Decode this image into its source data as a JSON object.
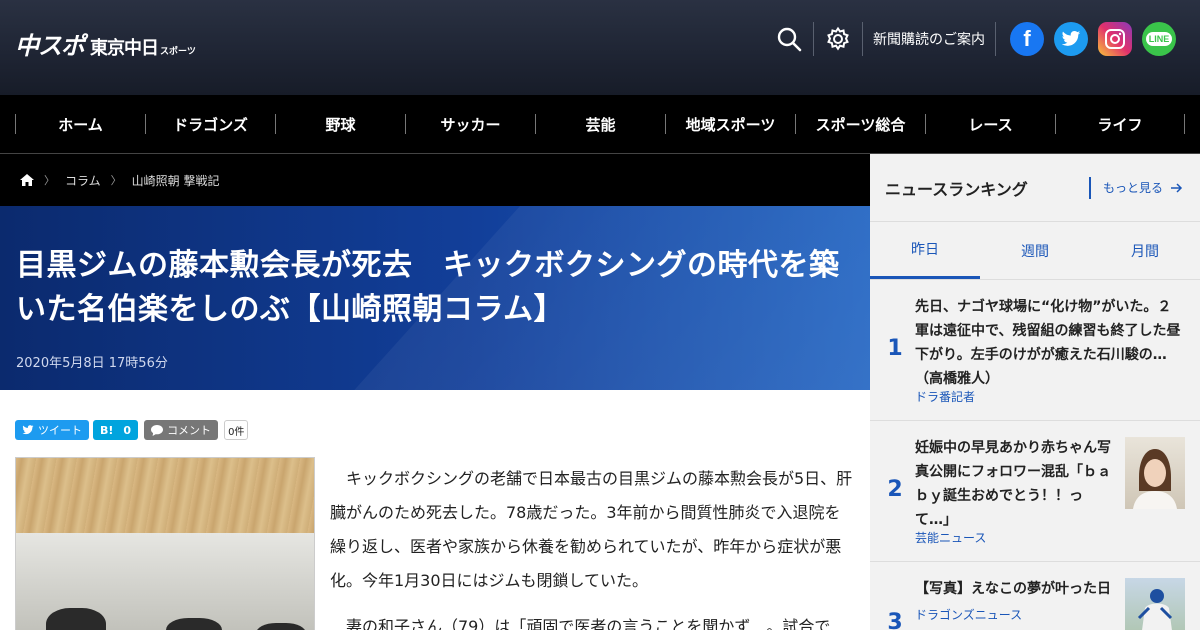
{
  "header": {
    "logo_main": "中スポ",
    "logo_sub": "東京中日",
    "logo_small": "スポーツ",
    "subscribe_label": "新聞購読のご案内",
    "social": [
      {
        "name": "facebook",
        "icon": "facebook-icon",
        "color": "#1877f2"
      },
      {
        "name": "twitter",
        "icon": "twitter-icon",
        "color": "#1d9bf0"
      },
      {
        "name": "instagram",
        "icon": "instagram-icon",
        "color": "#e1306c"
      },
      {
        "name": "line",
        "icon": "line-icon",
        "color": "#3ac44a",
        "label": "LINE"
      }
    ]
  },
  "nav": {
    "items": [
      "ホーム",
      "ドラゴンズ",
      "野球",
      "サッカー",
      "芸能",
      "地域スポーツ",
      "スポーツ総合",
      "レース",
      "ライフ"
    ]
  },
  "breadcrumb": {
    "home_icon": "home-icon",
    "items": [
      "コラム",
      "山崎照朝 撃戦記"
    ]
  },
  "article": {
    "title": "目黒ジムの藤本勲会長が死去　キックボクシングの時代を築いた名伯楽をしのぶ【山崎照朝コラム】",
    "date": "2020年5月8日 17時56分",
    "share": {
      "tweet_label": "ツイート",
      "hatena_label": "B!",
      "hatena_count": "0",
      "comment_label": "コメント",
      "comment_count": "0件"
    },
    "paragraphs": [
      "キックボクシングの老舗で日本最古の目黒ジムの藤本勲会長が5日、肝臓がんのため死去した。78歳だった。3年前から間質性肺炎で入退院を繰り返し、医者や家族から休養を勧められていたが、昨年から症状が悪化。今年1月30日にはジムも閉鎖していた。",
      "妻の和子さん（79）は「頑固で医者の言うことを聞かず…。試合で"
    ]
  },
  "sidebar": {
    "ranking_title": "ニュースランキング",
    "more_label": "もっと見る",
    "tabs": [
      "昨日",
      "週間",
      "月間"
    ],
    "active_tab": 0,
    "items": [
      {
        "rank": "1",
        "text": "先日、ナゴヤ球場に“化け物”がいた。２軍は遠征中で、残留組の練習も終了した昼下がり。左手のけがが癒えた石川駿の…（高橋雅人）",
        "category": "ドラ番記者"
      },
      {
        "rank": "2",
        "text": "妊娠中の早見あかり赤ちゃん写真公開にフォロワー混乱「ｂａｂｙ誕生おめでとう！！って…」",
        "category": "芸能ニュース"
      },
      {
        "rank": "3",
        "text": "【写真】えなこの夢が叶った日",
        "category": "ドラゴンズニュース"
      }
    ]
  },
  "colors": {
    "accent": "#1a56b8",
    "header_bg": "#1e2433",
    "nav_bg": "#000000",
    "hero_bg": "#123f9a"
  }
}
